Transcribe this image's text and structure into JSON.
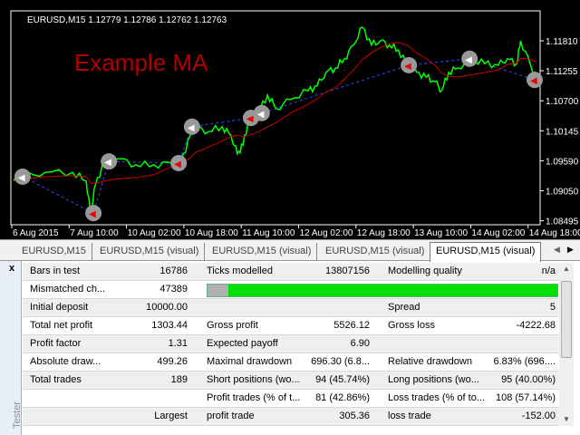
{
  "chart": {
    "symbol_info": "EURUSD,M15  1.12779 1.12786 1.12762 1.12763",
    "label": "Example MA",
    "label_color": "#b00000",
    "price_color": "#00ff00",
    "ma_color": "#cc0000",
    "trade_line_color": "#3050ff",
    "price_ticks": [
      "1.11810",
      "1.11255",
      "1.10700",
      "1.10145",
      "1.09590",
      "1.09050",
      "1.08495"
    ],
    "time_ticks": [
      "6 Aug 2015",
      "7 Aug 10:00",
      "10 Aug 02:00",
      "10 Aug 18:00",
      "11 Aug 10:00",
      "12 Aug 02:00",
      "12 Aug 18:00",
      "13 Aug 10:00",
      "14 Aug 02:00",
      "14 Aug 18:00"
    ]
  },
  "chart_data": {
    "type": "line",
    "x_unit": "hours from start",
    "series": [
      {
        "name": "EURUSD price",
        "points": [
          [
            0,
            1.0923
          ],
          [
            2.5,
            1.0931
          ],
          [
            8.8,
            1.0939
          ],
          [
            16.4,
            1.0939
          ],
          [
            20.2,
            1.0923
          ],
          [
            21.4,
            1.0864
          ],
          [
            22.7,
            1.0914
          ],
          [
            25.2,
            1.0959
          ],
          [
            29,
            1.0964
          ],
          [
            34,
            1.0953
          ],
          [
            39,
            1.0953
          ],
          [
            44,
            1.0956
          ],
          [
            46.6,
            1.0959
          ],
          [
            49.1,
            1.1006
          ],
          [
            50.4,
            1.1023
          ],
          [
            54.2,
            1.1014
          ],
          [
            58,
            1.1023
          ],
          [
            60.5,
            1.1006
          ],
          [
            62.2,
            1.0973
          ],
          [
            63.8,
            1.0989
          ],
          [
            65.5,
            1.1039
          ],
          [
            68,
            1.1048
          ],
          [
            70.6,
            1.1081
          ],
          [
            73.1,
            1.1056
          ],
          [
            76.9,
            1.1073
          ],
          [
            81.9,
            1.1089
          ],
          [
            84.4,
            1.1098
          ],
          [
            86.9,
            1.1123
          ],
          [
            89.5,
            1.1131
          ],
          [
            92,
            1.1148
          ],
          [
            94.5,
            1.1173
          ],
          [
            97,
            1.1206
          ],
          [
            99.5,
            1.1173
          ],
          [
            102,
            1.1181
          ],
          [
            104.5,
            1.1173
          ],
          [
            107,
            1.1164
          ],
          [
            109.6,
            1.1136
          ],
          [
            112.1,
            1.1123
          ],
          [
            114.7,
            1.1114
          ],
          [
            117.2,
            1.1106
          ],
          [
            119,
            1.1089
          ],
          [
            121,
            1.1123
          ],
          [
            123.5,
            1.1131
          ],
          [
            127.3,
            1.1148
          ],
          [
            131,
            1.1139
          ],
          [
            134.8,
            1.1136
          ],
          [
            137.3,
            1.1148
          ],
          [
            139.9,
            1.1139
          ],
          [
            141,
            1.1181
          ],
          [
            143.6,
            1.1139
          ],
          [
            145.4,
            1.1109
          ]
        ]
      }
    ],
    "trades": [
      [
        2.5,
        1.0931
      ],
      [
        22.2,
        1.0864
      ],
      [
        26.5,
        1.0959
      ],
      [
        45.9,
        1.0956
      ],
      [
        49.6,
        1.1023
      ],
      [
        66,
        1.1039
      ],
      [
        69,
        1.1048
      ],
      [
        109.9,
        1.1136
      ],
      [
        126.8,
        1.1148
      ],
      [
        144.9,
        1.1109
      ]
    ],
    "ylim": [
      1.08495,
      1.1206
    ]
  },
  "tabs": [
    "EURUSD,M15",
    "EURUSD,M15 (visual)",
    "EURUSD,M15 (visual)",
    "EURUSD,M15 (visual)",
    "EURUSD,M15 (visual)"
  ],
  "side": {
    "close": "x",
    "label": "Tester"
  },
  "modelling_quality_fraction": 0.06,
  "rows": [
    [
      "Bars in test",
      "16786",
      "Ticks modelled",
      "13807156",
      "Modelling quality",
      "n/a"
    ],
    [
      "Mismatched ch...",
      "47389",
      "",
      "",
      "",
      ""
    ],
    [
      "Initial deposit",
      "10000.00",
      "",
      "",
      "Spread",
      "5"
    ],
    [
      "Total net profit",
      "1303.44",
      "Gross profit",
      "5526.12",
      "Gross loss",
      "-4222.68"
    ],
    [
      "Profit factor",
      "1.31",
      "Expected payoff",
      "6.90",
      "",
      ""
    ],
    [
      "Absolute draw...",
      "499.26",
      "Maximal drawdown",
      "696.30 (6.8...",
      "Relative drawdown",
      "6.83% (696...."
    ],
    [
      "Total trades",
      "189",
      "Short positions (wo...",
      "94 (45.74%)",
      "Long positions (wo...",
      "95 (40.00%)"
    ],
    [
      "",
      "",
      "Profit trades (% of t...",
      "81 (42.86%)",
      "Loss trades (% of to...",
      "108 (57.14%)"
    ],
    [
      "",
      "Largest",
      "profit trade",
      "305.36",
      "loss trade",
      "-152.00"
    ]
  ]
}
